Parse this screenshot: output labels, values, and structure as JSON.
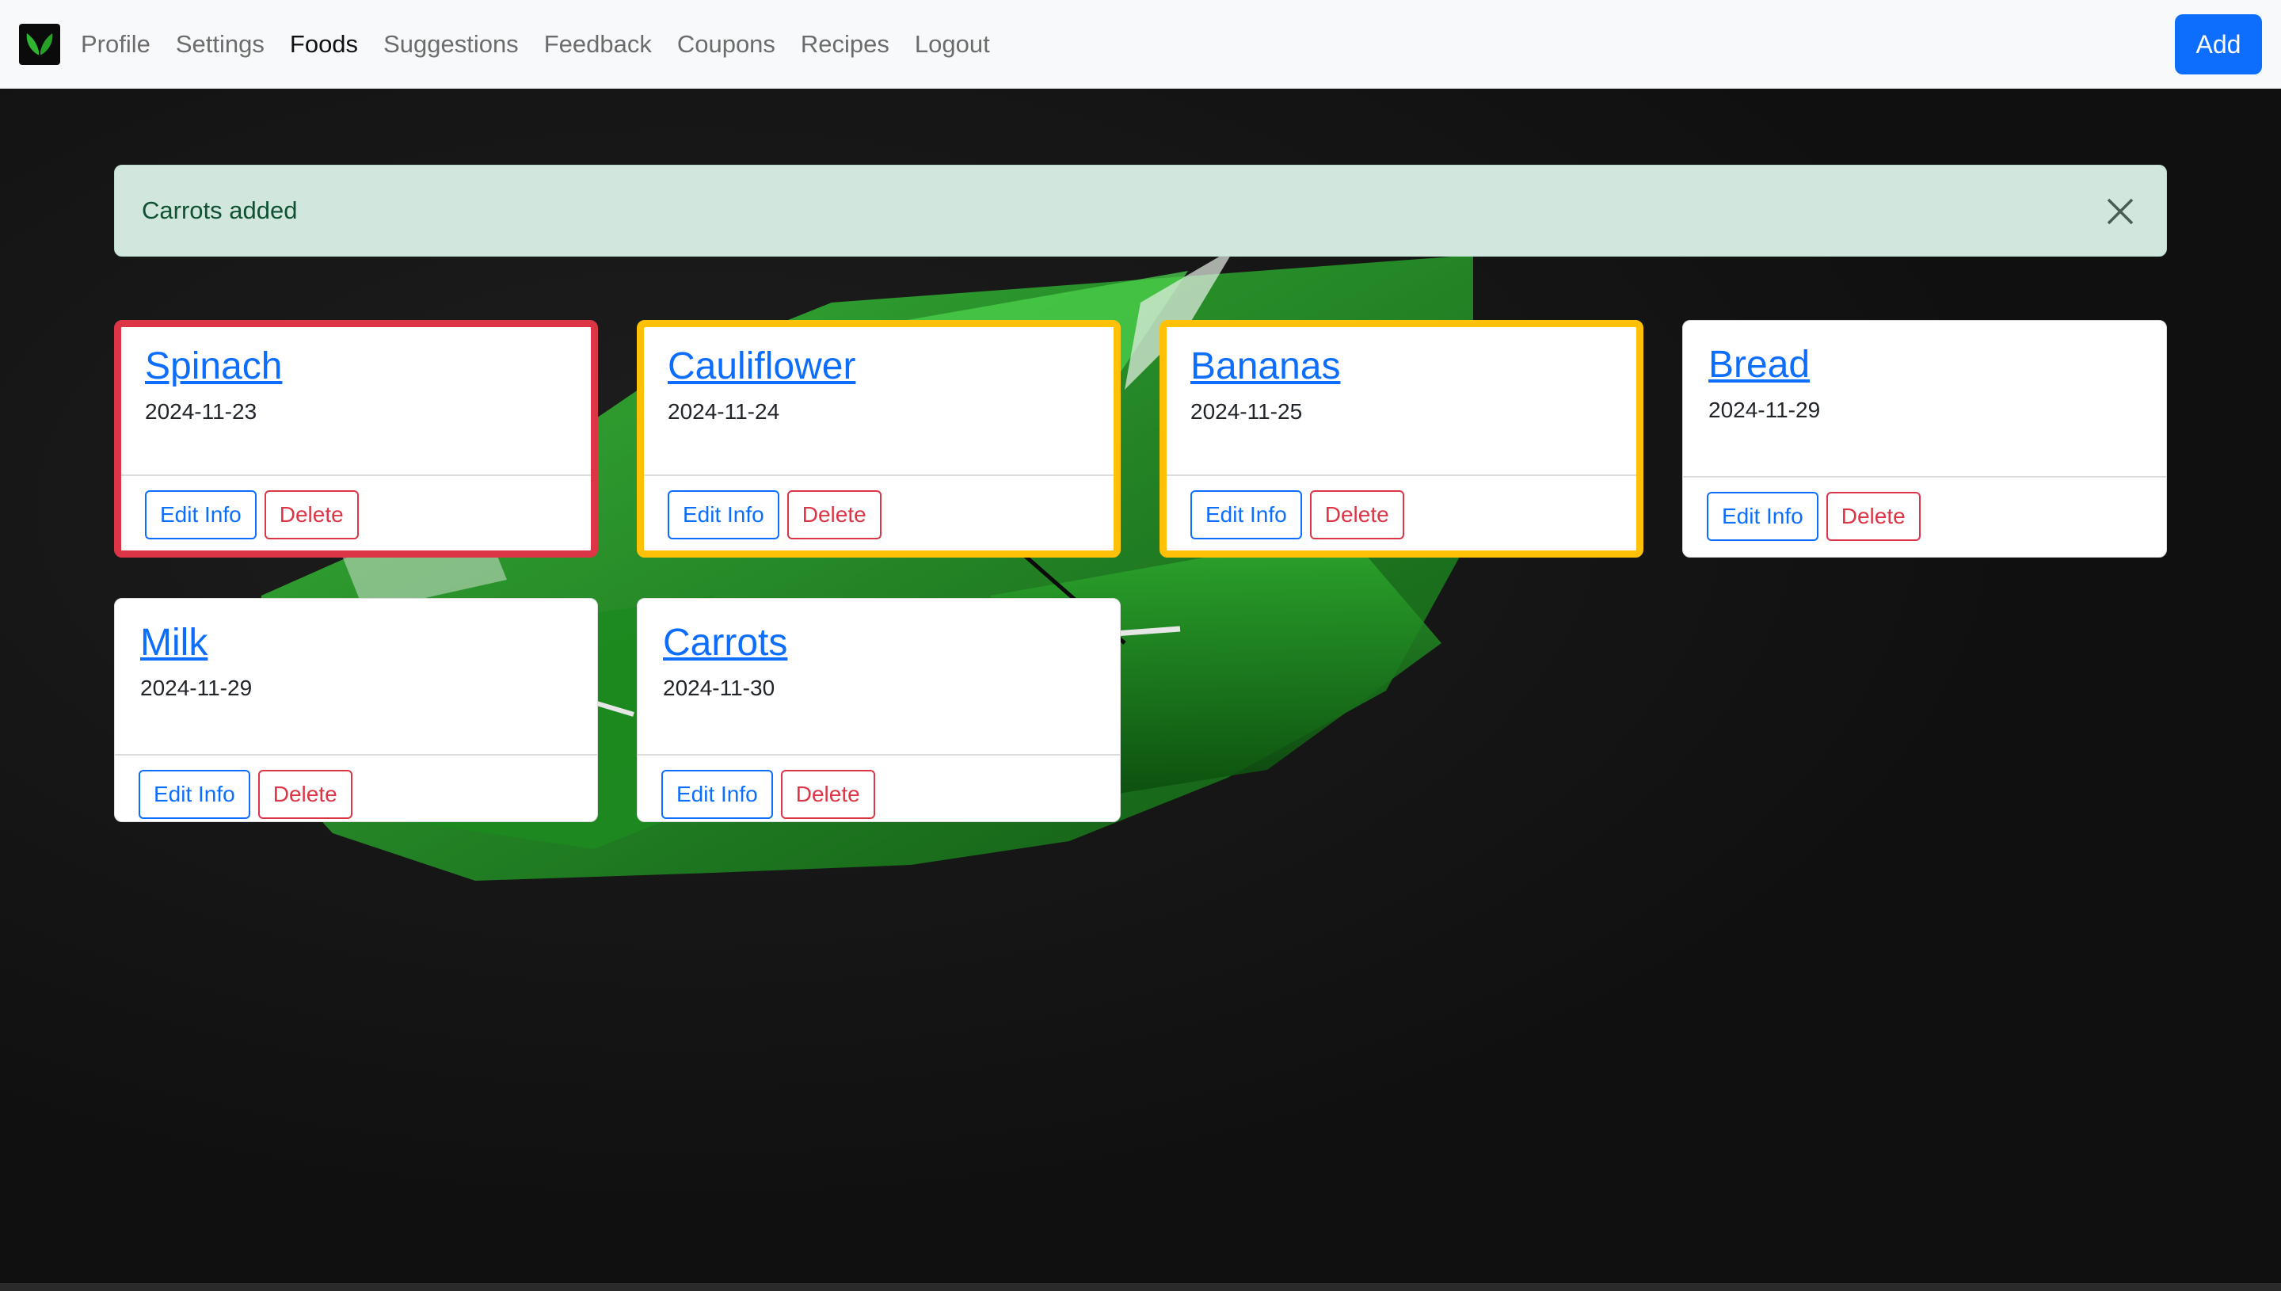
{
  "nav": {
    "items": [
      {
        "label": "Profile",
        "active": false
      },
      {
        "label": "Settings",
        "active": false
      },
      {
        "label": "Foods",
        "active": true
      },
      {
        "label": "Suggestions",
        "active": false
      },
      {
        "label": "Feedback",
        "active": false
      },
      {
        "label": "Coupons",
        "active": false
      },
      {
        "label": "Recipes",
        "active": false
      },
      {
        "label": "Logout",
        "active": false
      }
    ],
    "add_label": "Add"
  },
  "alert": {
    "text": "Carrots added",
    "color": "#d1e7dd"
  },
  "buttons": {
    "edit_label": "Edit Info",
    "delete_label": "Delete"
  },
  "foods": [
    {
      "name": "Spinach",
      "date": "2024-11-23",
      "highlight": "red"
    },
    {
      "name": "Cauliflower",
      "date": "2024-11-24",
      "highlight": "yellow"
    },
    {
      "name": "Bananas",
      "date": "2024-11-25",
      "highlight": "yellow"
    },
    {
      "name": "Bread",
      "date": "2024-11-29",
      "highlight": "none"
    },
    {
      "name": "Milk",
      "date": "2024-11-29",
      "highlight": "none"
    },
    {
      "name": "Carrots",
      "date": "2024-11-30",
      "highlight": "none"
    }
  ],
  "colors": {
    "red_border": "#dc3545",
    "yellow_border": "#ffc107",
    "primary": "#0d6efd"
  }
}
